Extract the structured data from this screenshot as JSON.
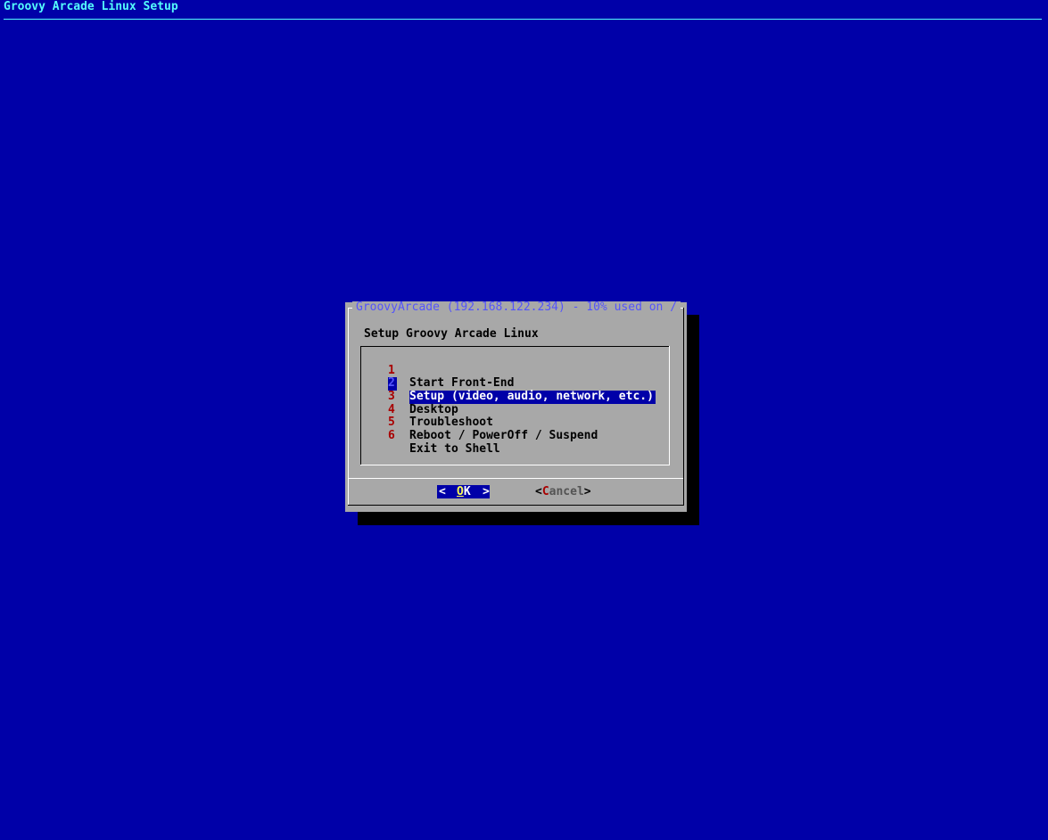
{
  "backtitle": "Groovy Arcade Linux Setup",
  "dialog": {
    "title": "GroovyArcade (192.168.122.234) - 10% used on /",
    "prompt": "Setup Groovy Arcade Linux",
    "selected_index": 1,
    "items": [
      {
        "num": "1",
        "label": "Start Front-End"
      },
      {
        "num": "2",
        "label": "Setup (video, audio, network, etc.)"
      },
      {
        "num": "3",
        "label": "Desktop"
      },
      {
        "num": "4",
        "label": "Troubleshoot"
      },
      {
        "num": "5",
        "label": "Reboot / PowerOff / Suspend"
      },
      {
        "num": "6",
        "label": "Exit to Shell"
      }
    ],
    "buttons": {
      "ok_left": "<",
      "ok_hotkey": "O",
      "ok_rest": "K",
      "ok_right": ">",
      "cancel_left": "<",
      "cancel_hotkey": "C",
      "cancel_rest": "ancel",
      "cancel_right": ">"
    }
  },
  "colors": {
    "background": "#0000a8",
    "dialog": "#a8a8a8",
    "title": "#5454fc",
    "item_number": "#a80000",
    "highlight": "#0000a8",
    "hotkey": "#fcfc54"
  }
}
